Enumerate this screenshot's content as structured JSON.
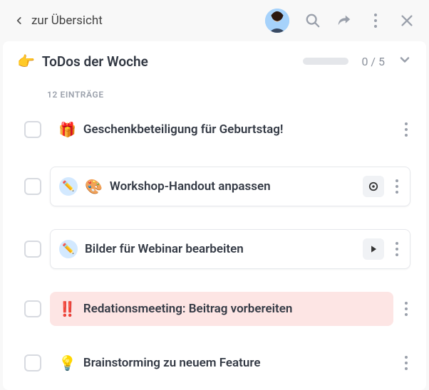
{
  "topbar": {
    "back_label": "zur Übersicht"
  },
  "section": {
    "emoji": "👉",
    "title": "ToDos der Woche",
    "progress": "0 / 5"
  },
  "list": {
    "count_label": "12 EINTRÄGE",
    "items": [
      {
        "emoji": "🎁",
        "text": "Geschenkbeteiligung für Geburtstag!",
        "style": "plain"
      },
      {
        "emoji": "🎨",
        "chip": "✏️",
        "text": "Workshop-Handout anpassen",
        "style": "card",
        "action": "record"
      },
      {
        "chip": "✏️",
        "text": "Bilder für Webinar bearbeiten",
        "style": "card",
        "action": "play"
      },
      {
        "emoji": "‼️",
        "text": "Redationsmeeting: Beitrag vorbereiten",
        "style": "highlight"
      },
      {
        "emoji": "💡",
        "text": "Brainstorming zu neuem Feature",
        "style": "plain"
      }
    ]
  }
}
